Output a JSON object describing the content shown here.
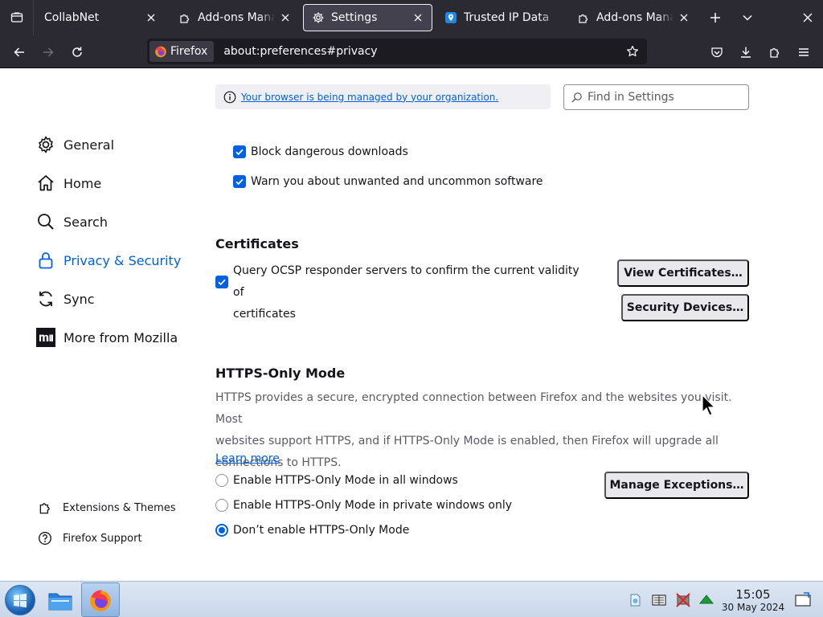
{
  "tabs": [
    {
      "title": "CollabNet",
      "selected": false
    },
    {
      "title": "Add-ons Manager",
      "selected": false
    },
    {
      "title": "Settings",
      "selected": true
    },
    {
      "title": "Trusted IP Data",
      "selected": false
    },
    {
      "title": "Add-ons Manager",
      "selected": false
    }
  ],
  "urlbar": {
    "identity_label": "Firefox",
    "url": "about:preferences#privacy"
  },
  "policy_banner": {
    "link_text": "Your browser is being managed by your organization."
  },
  "search": {
    "placeholder": "Find in Settings"
  },
  "sidebar": {
    "items": [
      {
        "label": "General",
        "icon": "gear-icon"
      },
      {
        "label": "Home",
        "icon": "home-icon"
      },
      {
        "label": "Search",
        "icon": "search-icon"
      },
      {
        "label": "Privacy & Security",
        "icon": "lock-icon",
        "selected": true
      },
      {
        "label": "Sync",
        "icon": "sync-icon"
      },
      {
        "label": "More from Mozilla",
        "icon": "mozilla-icon"
      }
    ],
    "footer": [
      {
        "label": "Extensions & Themes",
        "icon": "puzzle-icon"
      },
      {
        "label": "Firefox Support",
        "icon": "help-icon"
      }
    ]
  },
  "security": {
    "block_downloads": {
      "label": "Block dangerous downloads",
      "checked": true
    },
    "warn_unwanted": {
      "label": "Warn you about unwanted and uncommon software",
      "checked": true
    }
  },
  "certificates": {
    "title": "Certificates",
    "ocsp_line1": "Query OCSP responder servers to confirm the current validity of",
    "ocsp_line2": "certificates",
    "ocsp_checked": true,
    "view_certificates": "View Certificates…",
    "security_devices": "Security Devices…"
  },
  "https_only": {
    "title": "HTTPS-Only Mode",
    "desc_line1": "HTTPS provides a secure, encrypted connection between Firefox and the websites you visit. Most",
    "desc_line2": "websites support HTTPS, and if HTTPS-Only Mode is enabled, then Firefox will upgrade all",
    "desc_line3": "connections to HTTPS.",
    "learn_more": "Learn more",
    "manage_exceptions": "Manage Exceptions…",
    "options": [
      {
        "label": "Enable HTTPS-Only Mode in all windows",
        "selected": false
      },
      {
        "label": "Enable HTTPS-Only Mode in private windows only",
        "selected": false
      },
      {
        "label": "Don’t enable HTTPS-Only Mode",
        "selected": true
      }
    ]
  },
  "taskbar": {
    "time": "15:05",
    "date": "30 May 2024"
  },
  "colors": {
    "accent": "#0061e0",
    "chrome_dark": "#2b2a33",
    "taskbar": "#dde7f3"
  }
}
